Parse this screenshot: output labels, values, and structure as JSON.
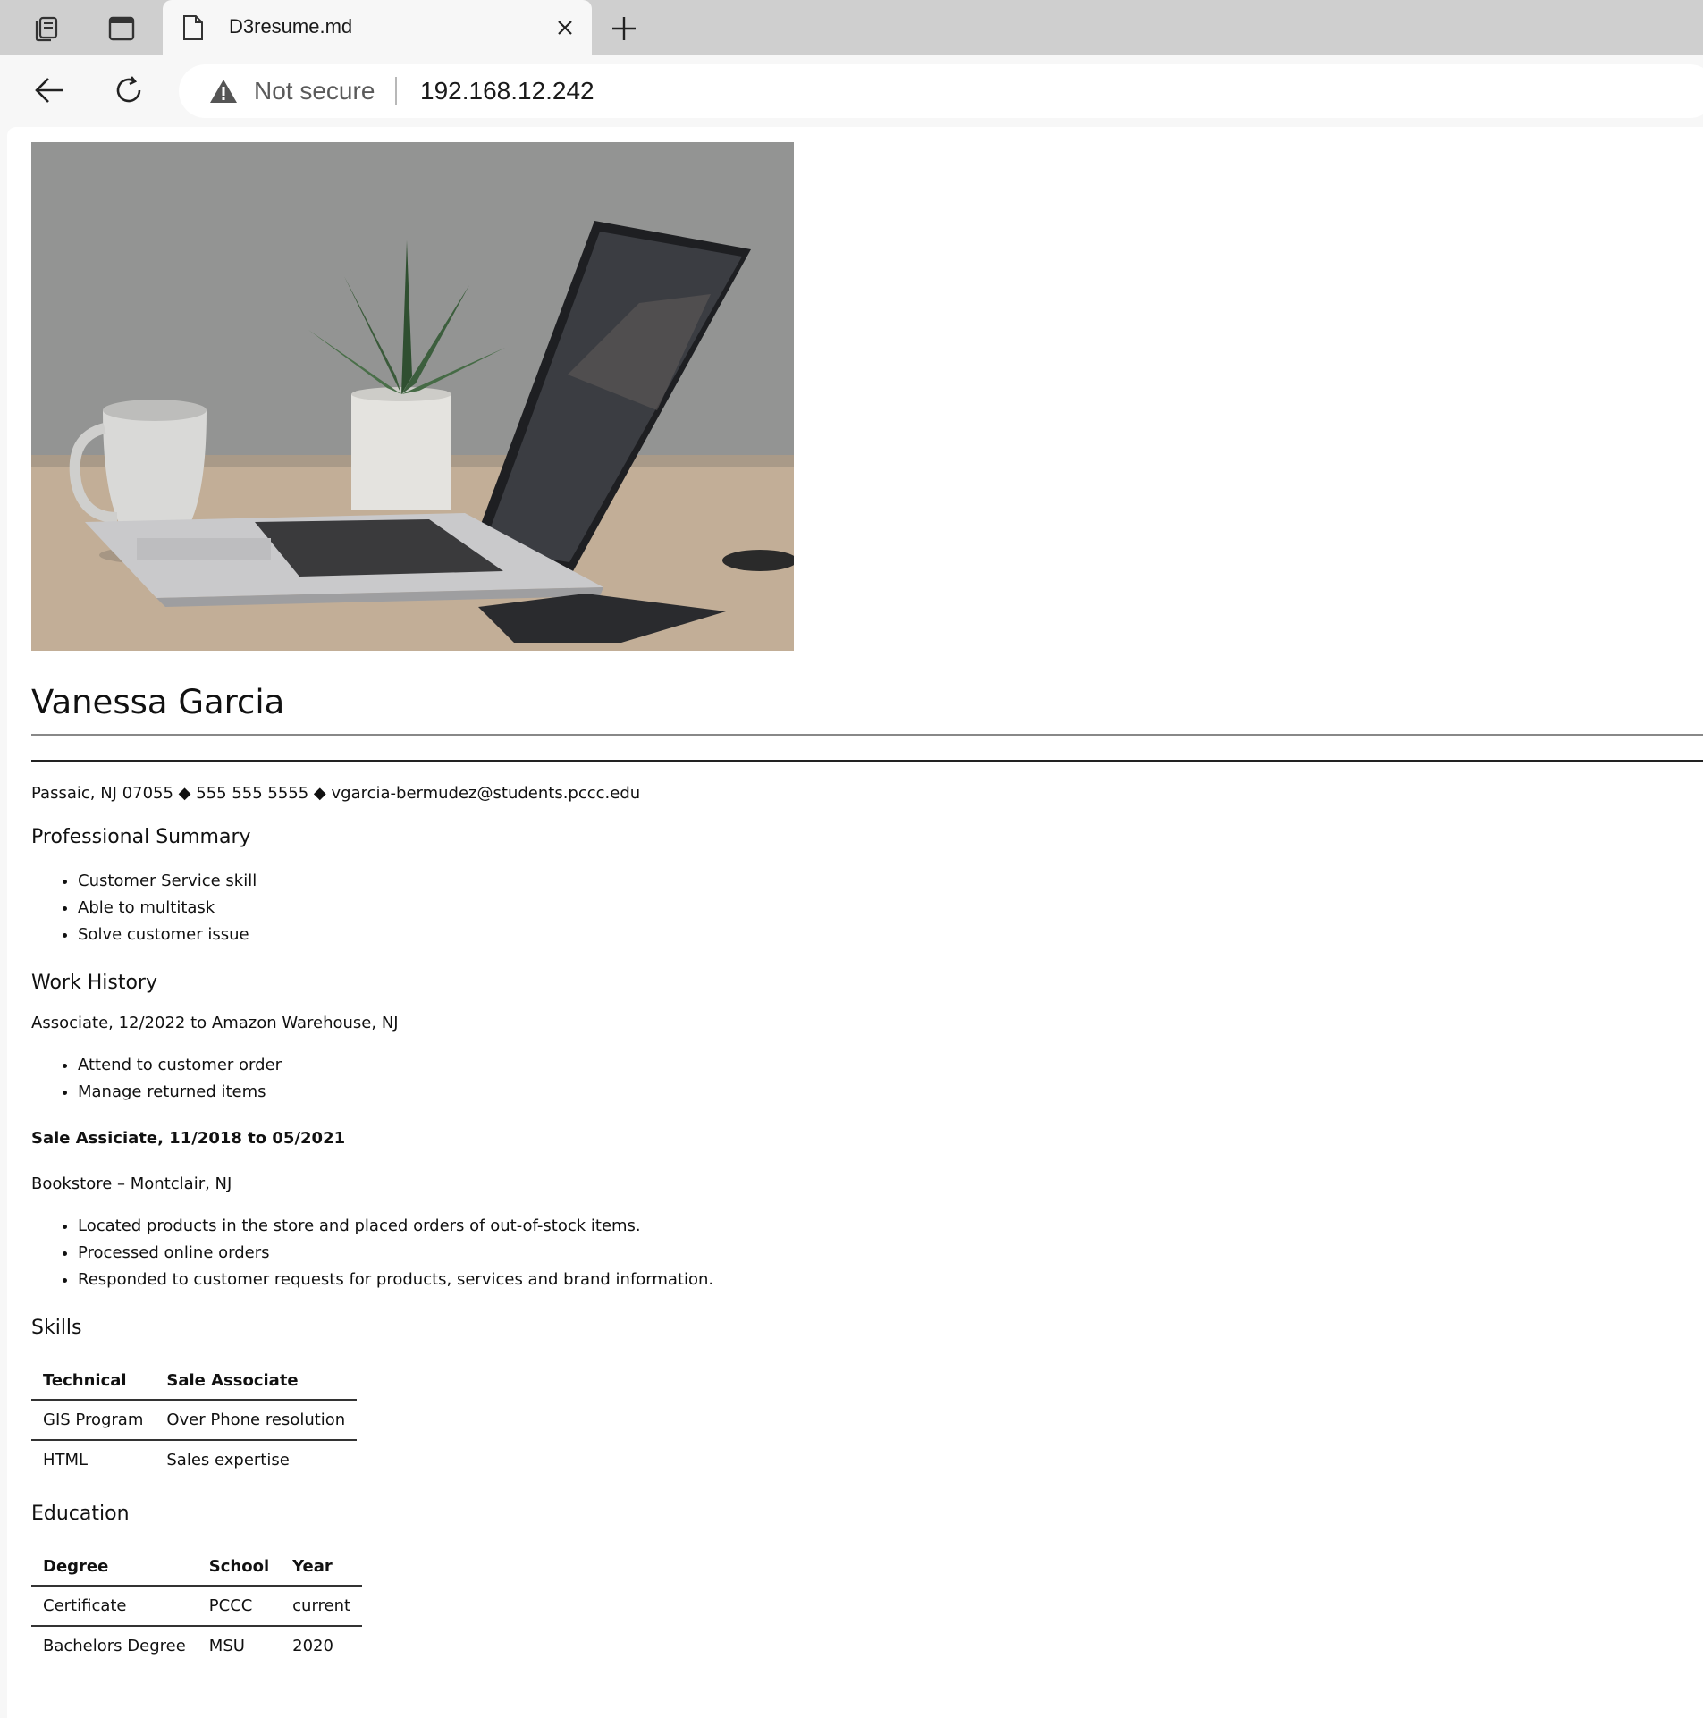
{
  "browser": {
    "tab": {
      "title": "D3resume.md"
    },
    "address": {
      "security_label": "Not secure",
      "url": "192.168.12.242"
    }
  },
  "resume": {
    "name": "Vanessa Garcia",
    "contact": "Passaic, NJ 07055 ◆ 555 555 5555 ◆ vgarcia-bermudez@students.pccc.edu",
    "summary_heading": "Professional Summary",
    "summary_items": [
      "Customer Service skill",
      "Able to multitask",
      "Solve customer issue"
    ],
    "work_heading": "Work History",
    "job1_line": "Associate, 12/2022 to Amazon Warehouse, NJ",
    "job1_items": [
      "Attend to customer order",
      "Manage returned items"
    ],
    "job2_title": "Sale Assiciate, 11/2018 to 05/2021",
    "job2_place": "Bookstore – Montclair, NJ",
    "job2_items": [
      "Located products in the store and placed orders of out-of-stock items.",
      "Processed online orders",
      "Responded to customer requests for products, services and brand information."
    ],
    "skills_heading": "Skills",
    "skills_table": {
      "headers": [
        "Technical",
        "Sale Associate"
      ],
      "rows": [
        [
          "GIS Program",
          "Over Phone resolution"
        ],
        [
          "HTML",
          "Sales expertise"
        ]
      ]
    },
    "education_heading": "Education",
    "education_table": {
      "headers": [
        "Degree",
        "School",
        "Year"
      ],
      "rows": [
        [
          "Certificate",
          "PCCC",
          "current"
        ],
        [
          "Bachelors Degree",
          "MSU",
          "2020"
        ]
      ]
    }
  },
  "icons": {
    "collections": "collections-icon",
    "tab_actions": "tab-actions-icon",
    "page": "page-icon",
    "close": "close-icon",
    "new_tab": "plus-icon",
    "back": "back-arrow-icon",
    "refresh": "refresh-icon",
    "warning": "warning-icon"
  }
}
